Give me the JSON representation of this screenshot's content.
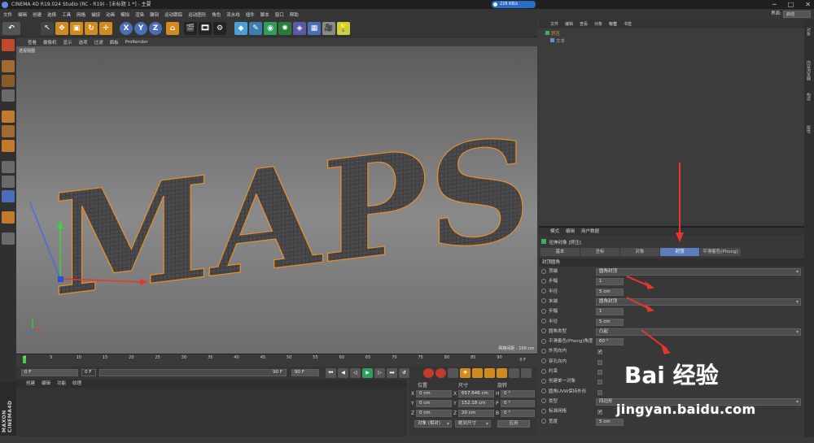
{
  "window": {
    "title": "CINEMA 4D R19.024 Studio (RC - R19) - [未标题 1 *] - 主要",
    "net_speed": "226 KB/s",
    "layout_label": "界面:",
    "layout_value": "启动"
  },
  "menu": [
    "文件",
    "编辑",
    "创建",
    "选择",
    "工具",
    "网格",
    "捕捉",
    "动画",
    "模拟",
    "渲染",
    "雕刻",
    "运动跟踪",
    "运动图形",
    "角色",
    "流水线",
    "插件",
    "脚本",
    "窗口",
    "帮助"
  ],
  "toolbar": {
    "axes": [
      "X",
      "Y",
      "Z"
    ]
  },
  "viewport": {
    "menu": [
      "查看",
      "摄像机",
      "显示",
      "选项",
      "过滤",
      "面板",
      "ProRender"
    ],
    "label": "透视视图",
    "grid_info": "网格间距 : 100 cm",
    "scene_text": "MAPS"
  },
  "timeline": {
    "ticks": [
      "0",
      "5",
      "10",
      "15",
      "20",
      "25",
      "30",
      "35",
      "40",
      "45",
      "50",
      "55",
      "60",
      "65",
      "70",
      "75",
      "80",
      "85",
      "90"
    ],
    "end_frame": "0 F",
    "start_field": "0 F",
    "current_field": "0 F",
    "range_end": "90 F",
    "range_end2": "90 F"
  },
  "material_panel": {
    "tabs": [
      "创建",
      "编辑",
      "功能",
      "纹理"
    ]
  },
  "coords": {
    "headers": [
      "位置",
      "尺寸",
      "旋转"
    ],
    "rows": [
      {
        "axis": "X",
        "pos": "0 cm",
        "size_axis": "X",
        "size": "657.646 cm",
        "rot_axis": "H",
        "rot": "0 °"
      },
      {
        "axis": "Y",
        "pos": "0 cm",
        "size_axis": "Y",
        "size": "152.18 cm",
        "rot_axis": "P",
        "rot": "0 °"
      },
      {
        "axis": "Z",
        "pos": "0 cm",
        "size_axis": "Z",
        "size": "20 cm",
        "rot_axis": "B",
        "rot": "0 °"
      }
    ],
    "mode1": "对象 (相对)",
    "mode2": "绝对尺寸",
    "apply": "应用"
  },
  "objects": {
    "tabs": [
      "文件",
      "编辑",
      "查看",
      "对象",
      "标签",
      "书签"
    ],
    "items": [
      {
        "name": "挤压"
      },
      {
        "name": "文本"
      }
    ]
  },
  "attributes": {
    "tabs_top": [
      "模式",
      "编辑",
      "用户数据"
    ],
    "object_title": "拉伸对象 [挤压]",
    "tabs": [
      "基本",
      "坐标",
      "对象",
      "封顶",
      "平滑着色(Phong)"
    ],
    "active_tab": "封顶",
    "section": "封顶圆角",
    "rows": [
      {
        "label": "顶端",
        "value": "圆角封顶",
        "type": "dropdown"
      },
      {
        "label": "步幅",
        "value": "1",
        "type": "field"
      },
      {
        "label": "半径",
        "value": "5 cm",
        "type": "field"
      },
      {
        "label": "末端",
        "value": "圆角封顶",
        "type": "dropdown"
      },
      {
        "label": "步幅",
        "value": "1",
        "type": "field"
      },
      {
        "label": "半径",
        "value": "5 cm",
        "type": "field"
      },
      {
        "label": "圆角类型",
        "value": "凸起",
        "type": "dropdown"
      },
      {
        "label": "平滑着色(Phong)角度",
        "value": "60 °",
        "type": "field"
      },
      {
        "label": "外壳向内",
        "value": "",
        "type": "check",
        "checked": true
      },
      {
        "label": "穿孔向内",
        "value": "",
        "type": "check",
        "checked": false
      },
      {
        "label": "约束",
        "value": "",
        "type": "check",
        "checked": false
      },
      {
        "label": "创建单一对象",
        "value": "",
        "type": "check",
        "checked": false
      },
      {
        "label": "圆角UVW保持外形",
        "value": "",
        "type": "check",
        "checked": false
      },
      {
        "label": "类型",
        "value": "四边形",
        "type": "dropdown"
      },
      {
        "label": "标准网格",
        "value": "",
        "type": "check",
        "checked": true
      },
      {
        "label": "宽度",
        "value": "5 cm",
        "type": "field"
      }
    ]
  },
  "right_strip": [
    "对象",
    "内容浏览器",
    "构造",
    "属性"
  ],
  "watermark": {
    "logo": "Bai 经验",
    "url": "jingyan.baidu.com"
  },
  "colors": {
    "accent": "#5c7cbf",
    "arrow": "#e8362a",
    "selection_orange": "#e8902a"
  }
}
